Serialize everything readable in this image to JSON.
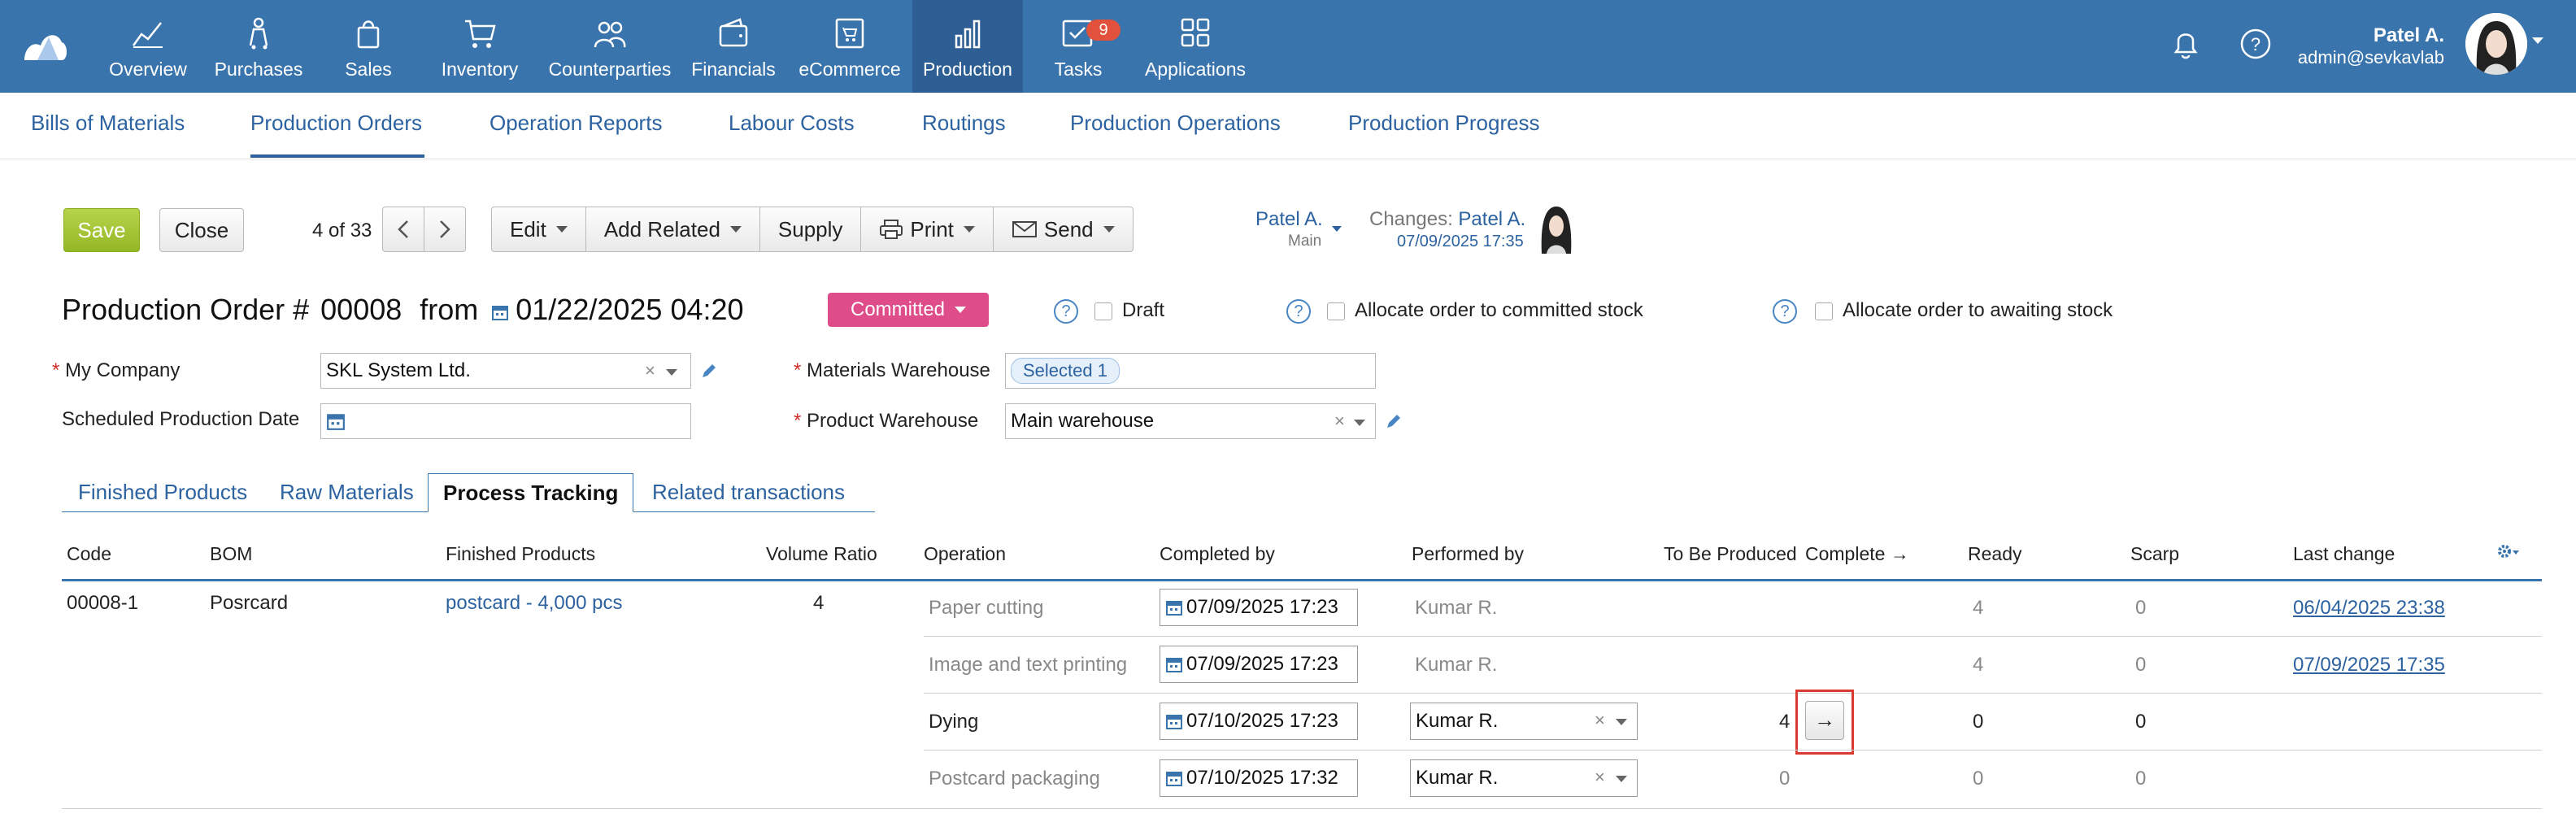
{
  "topnav": {
    "items": [
      {
        "label": "Overview",
        "icon": "chart-line-icon"
      },
      {
        "label": "Purchases",
        "icon": "cart-person-icon"
      },
      {
        "label": "Sales",
        "icon": "shopping-bag-icon"
      },
      {
        "label": "Inventory",
        "icon": "shopping-cart-icon"
      },
      {
        "label": "Counterparties",
        "icon": "people-icon"
      },
      {
        "label": "Financials",
        "icon": "wallet-icon"
      },
      {
        "label": "eCommerce",
        "icon": "storefront-icon"
      },
      {
        "label": "Production",
        "icon": "bar-chart-icon"
      },
      {
        "label": "Tasks",
        "icon": "tasks-icon"
      },
      {
        "label": "Applications",
        "icon": "apps-grid-icon"
      }
    ],
    "active": "Production",
    "tasks_badge": "9",
    "user_name": "Patel A.",
    "user_email": "admin@sevkavlab"
  },
  "subnav": {
    "items": [
      "Bills of Materials",
      "Production Orders",
      "Operation Reports",
      "Labour Costs",
      "Routings",
      "Production Operations",
      "Production Progress"
    ],
    "active": "Production Orders"
  },
  "toolbar": {
    "save": "Save",
    "close": "Close",
    "counter": "4 of 33",
    "edit": "Edit",
    "add_related": "Add Related",
    "supply": "Supply",
    "print": "Print",
    "send": "Send"
  },
  "responsible": {
    "name": "Patel A.",
    "dept": "Main",
    "changes_label": "Changes:",
    "changes_by": "Patel A.",
    "changes_date": "07/09/2025 17:35"
  },
  "header": {
    "title": "Production Order #",
    "number": "00008",
    "from": "from",
    "date": "01/22/2025 04:20",
    "status": "Committed",
    "draft_label": "Draft",
    "alloc_committed": "Allocate order to committed stock",
    "alloc_awaiting": "Allocate order to awaiting stock"
  },
  "form": {
    "my_company_label": "My Company",
    "my_company_value": "SKL System Ltd.",
    "scheduled_label": "Scheduled Production Date",
    "scheduled_value": "",
    "materials_wh_label": "Materials Warehouse",
    "materials_wh_tag": "Selected 1",
    "product_wh_label": "Product Warehouse",
    "product_wh_value": "Main warehouse"
  },
  "tabs": [
    "Finished Products",
    "Raw Materials",
    "Process Tracking",
    "Related transactions"
  ],
  "active_tab": "Process Tracking",
  "table": {
    "headers": {
      "code": "Code",
      "bom": "BOM",
      "finished": "Finished Products",
      "ratio": "Volume Ratio",
      "operation": "Operation",
      "completed_by": "Completed by",
      "performed_by": "Performed by",
      "to_be_produced": "To Be Produced",
      "complete": "Complete →",
      "ready": "Ready",
      "scarp": "Scarp",
      "last_change": "Last change"
    },
    "group": {
      "code": "00008-1",
      "bom": "Posrcard",
      "finished": "postcard - 4,000 pcs",
      "ratio": "4"
    },
    "rows": [
      {
        "operation": "Paper cutting",
        "completed_by": "07/09/2025 17:23",
        "performed_by": "Kumar R.",
        "to_be_produced": "",
        "ready": "4",
        "scarp": "0",
        "last_change": "06/04/2025 23:38"
      },
      {
        "operation": "Image and text printing",
        "completed_by": "07/09/2025 17:23",
        "performed_by": "Kumar R.",
        "to_be_produced": "",
        "ready": "4",
        "scarp": "0",
        "last_change": "07/09/2025 17:35"
      },
      {
        "operation": "Dying",
        "completed_by": "07/10/2025 17:23",
        "performed_by": "Kumar R.",
        "to_be_produced": "4",
        "complete_button": "→",
        "ready": "0",
        "scarp": "0",
        "last_change": ""
      },
      {
        "operation": "Postcard packaging",
        "completed_by": "07/10/2025 17:32",
        "performed_by": "Kumar R.",
        "to_be_produced": "0",
        "ready": "0",
        "scarp": "0",
        "last_change": ""
      }
    ]
  },
  "colors": {
    "nav": "#3a74ad",
    "nav_active": "#2d5f94",
    "link": "#2c62a0",
    "status": "#de4c8a",
    "save": "#a3c534",
    "highlight": "#d93b30"
  }
}
